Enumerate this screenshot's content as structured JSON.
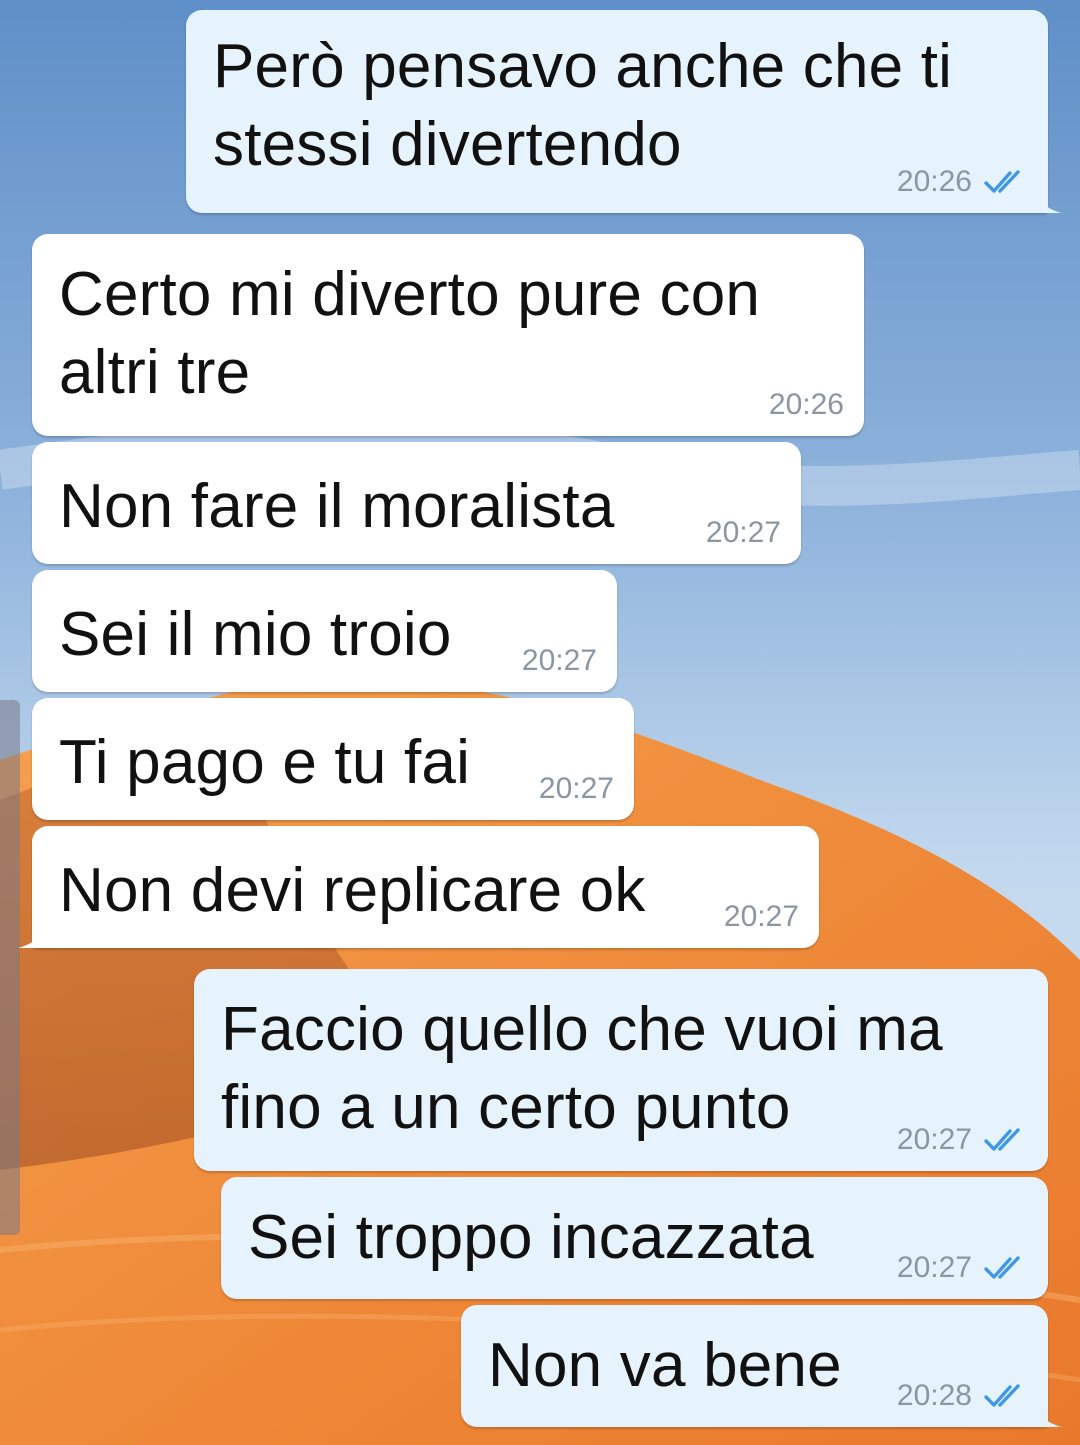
{
  "chat": {
    "messages": [
      {
        "id": "m1",
        "direction": "outgoing",
        "lines": [
          "Però pensavo anche che ti",
          "stessi divertendo"
        ],
        "time": "20:26",
        "status": "read",
        "status_icon": "double-check-icon"
      },
      {
        "id": "m2",
        "direction": "incoming",
        "lines": [
          "Certo mi diverto pure con",
          "altri tre"
        ],
        "time": "20:26"
      },
      {
        "id": "m3",
        "direction": "incoming",
        "lines": [
          "Non fare il moralista"
        ],
        "time": "20:27"
      },
      {
        "id": "m4",
        "direction": "incoming",
        "lines": [
          "Sei il mio troio"
        ],
        "time": "20:27"
      },
      {
        "id": "m5",
        "direction": "incoming",
        "lines": [
          "Ti pago e tu fai"
        ],
        "time": "20:27"
      },
      {
        "id": "m6",
        "direction": "incoming",
        "lines": [
          "Non devi replicare ok"
        ],
        "time": "20:27"
      },
      {
        "id": "m7",
        "direction": "outgoing",
        "lines": [
          "Faccio quello che vuoi ma",
          "fino a un certo punto"
        ],
        "time": "20:27",
        "status": "read",
        "status_icon": "double-check-icon"
      },
      {
        "id": "m8",
        "direction": "outgoing",
        "lines": [
          "Sei troppo incazzata"
        ],
        "time": "20:27",
        "status": "read",
        "status_icon": "double-check-icon"
      },
      {
        "id": "m9",
        "direction": "outgoing",
        "lines": [
          "Non va bene"
        ],
        "time": "20:28",
        "status": "read",
        "status_icon": "double-check-icon"
      }
    ]
  },
  "colors": {
    "outgoing_bubble": "#e6f2fc",
    "incoming_bubble": "#ffffff",
    "read_check": "#3f98e6",
    "time_text": "#8a97a3",
    "sky": "#a9c8e8",
    "dune": "#f0913e"
  }
}
